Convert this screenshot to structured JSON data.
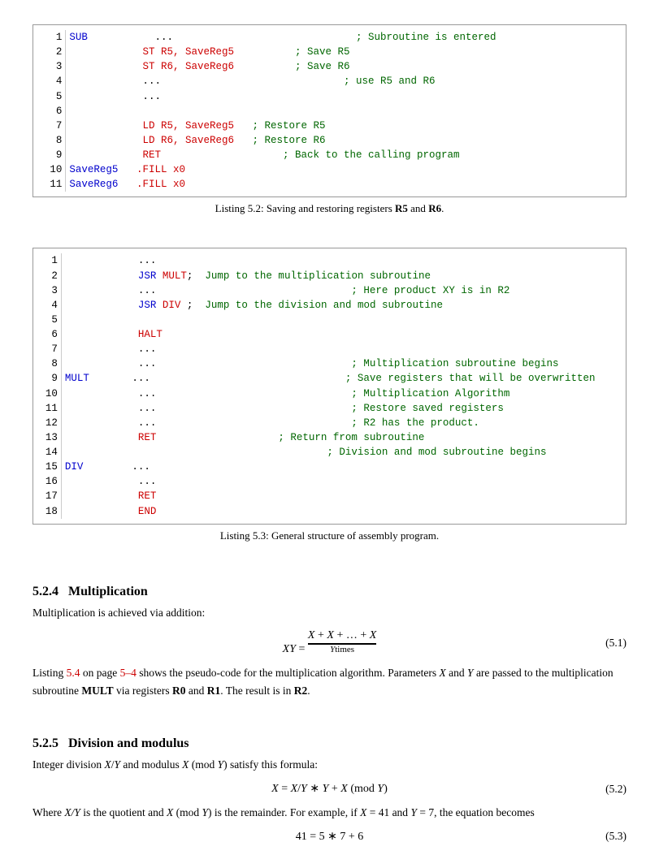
{
  "listing52": {
    "caption": "Listing 5.2: Saving and restoring registers ",
    "caption_bold": "R5",
    "caption_mid": " and ",
    "caption_bold2": "R6",
    "caption_end": ".",
    "lines": [
      {
        "num": "1",
        "label": "SUB",
        "indent": 0,
        "code": "...",
        "comment": "; Subroutine is entered"
      },
      {
        "num": "2",
        "label": "",
        "indent": 1,
        "code": "ST R5, SaveReg5",
        "comment": "; Save R5"
      },
      {
        "num": "3",
        "label": "",
        "indent": 1,
        "code": "ST R6, SaveReg6",
        "comment": "; Save R6"
      },
      {
        "num": "4",
        "label": "",
        "indent": 1,
        "code": "...",
        "comment": "; use R5 and R6"
      },
      {
        "num": "5",
        "label": "",
        "indent": 1,
        "code": "...",
        "comment": ""
      },
      {
        "num": "6",
        "label": "",
        "indent": 0,
        "code": "",
        "comment": ""
      },
      {
        "num": "7",
        "label": "",
        "indent": 1,
        "code": "LD R5, SaveReg5",
        "comment": "; Restore R5"
      },
      {
        "num": "8",
        "label": "",
        "indent": 1,
        "code": "LD R6, SaveReg6",
        "comment": "; Restore R6"
      },
      {
        "num": "9",
        "label": "",
        "indent": 1,
        "code": "RET",
        "comment": "; Back to the calling program"
      },
      {
        "num": "10",
        "label": "SaveReg5",
        "indent": 0,
        "code": ".FILL x0",
        "comment": ""
      },
      {
        "num": "11",
        "label": "SaveReg6",
        "indent": 0,
        "code": ".FILL x0",
        "comment": ""
      }
    ]
  },
  "listing53": {
    "caption": "Listing 5.3: General structure of assembly program.",
    "lines": [
      {
        "num": "1",
        "label": "",
        "code_type": "dots",
        "code": "...",
        "comment": ""
      },
      {
        "num": "2",
        "label": "",
        "code_type": "jsr",
        "code": "JSR MULT",
        "comment": "; Jump to the multiplication subroutine"
      },
      {
        "num": "3",
        "label": "",
        "code_type": "dots",
        "code": "...",
        "comment": "; Here product XY is in R2"
      },
      {
        "num": "4",
        "label": "",
        "code_type": "jsr",
        "code": "JSR DIV",
        "comment": "; Jump to the division and mod subroutine"
      },
      {
        "num": "5",
        "label": "",
        "code_type": "blank",
        "code": "",
        "comment": ""
      },
      {
        "num": "6",
        "label": "",
        "code_type": "halt",
        "code": "HALT",
        "comment": ""
      },
      {
        "num": "7",
        "label": "",
        "code_type": "dots",
        "code": "...",
        "comment": ""
      },
      {
        "num": "8",
        "label": "",
        "code_type": "dots",
        "code": "...",
        "comment": "; Multiplication subroutine begins"
      },
      {
        "num": "9",
        "label": "MULT",
        "code_type": "dots",
        "code": "...",
        "comment": "; Save registers that will be overwritten"
      },
      {
        "num": "10",
        "label": "",
        "code_type": "dots",
        "code": "...",
        "comment": "; Multiplication Algorithm"
      },
      {
        "num": "11",
        "label": "",
        "code_type": "dots",
        "code": "...",
        "comment": "; Restore saved registers"
      },
      {
        "num": "12",
        "label": "",
        "code_type": "dots",
        "code": "...",
        "comment": "; R2 has the product."
      },
      {
        "num": "13",
        "label": "",
        "code_type": "ret",
        "code": "RET",
        "comment": "; Return from subroutine"
      },
      {
        "num": "14",
        "label": "",
        "code_type": "dots",
        "code": "...",
        "comment": "; Division and mod subroutine begins"
      },
      {
        "num": "15",
        "label": "DIV",
        "code_type": "dots",
        "code": "...",
        "comment": ""
      },
      {
        "num": "16",
        "label": "",
        "code_type": "blank",
        "code": "",
        "comment": ""
      },
      {
        "num": "17",
        "label": "",
        "code_type": "ret",
        "code": "RET",
        "comment": ""
      },
      {
        "num": "18",
        "label": "",
        "code_type": "end",
        "code": "END",
        "comment": ""
      }
    ]
  },
  "section524": {
    "number": "5.2.4",
    "title": "Multiplication",
    "body1": "Multiplication is achieved via addition:",
    "eq51_label": "(5.1)",
    "eq51_ytimes": "Ytimes",
    "body2_pre": "Listing ",
    "body2_link": "5.4",
    "body2_mid": " on page ",
    "body2_page": "5–4",
    "body2_rest": " shows the pseudo-code for the multiplication algorithm.  Parameters ",
    "body2_X": "X",
    "body2_and": " and\n",
    "body2_Y": "Y",
    "body2_are": " are passed to the multiplication subroutine ",
    "body2_MULT": "MULT",
    "body2_via": " via registers ",
    "body2_R0": "R0",
    "body2_and2": " and ",
    "body2_R1": "R1",
    "body2_result": ". The result is in ",
    "body2_R2": "R2",
    "body2_end": "."
  },
  "section525": {
    "number": "5.2.5",
    "title": "Division and modulus",
    "body1": "Integer division ",
    "body1_X": "X",
    "body1_slash": "/",
    "body1_Y": "Y",
    "body1_rest": " and modulus ",
    "body1_X2": "X",
    "body1_mod": " (mod ",
    "body1_Y2": "Y",
    "body1_end": ") satisfy this formula:",
    "eq52_label": "(5.2)",
    "body2_pre": "Where ",
    "body2_XslashY": "X/Y",
    "body2_mid": " is the quotient and ",
    "body2_XmodY": "X",
    "body2_modY": " (mod ",
    "body2_Y": "Y",
    "body2_close": ")",
    "body2_rest": " is the remainder. For example, if ",
    "body2_X41": "X",
    "body2_eq41": " = 41 and ",
    "body2_Y7": "Y",
    "body2_eq7": " = 7, the\nequation becomes",
    "eq53_label": "(5.3)"
  }
}
